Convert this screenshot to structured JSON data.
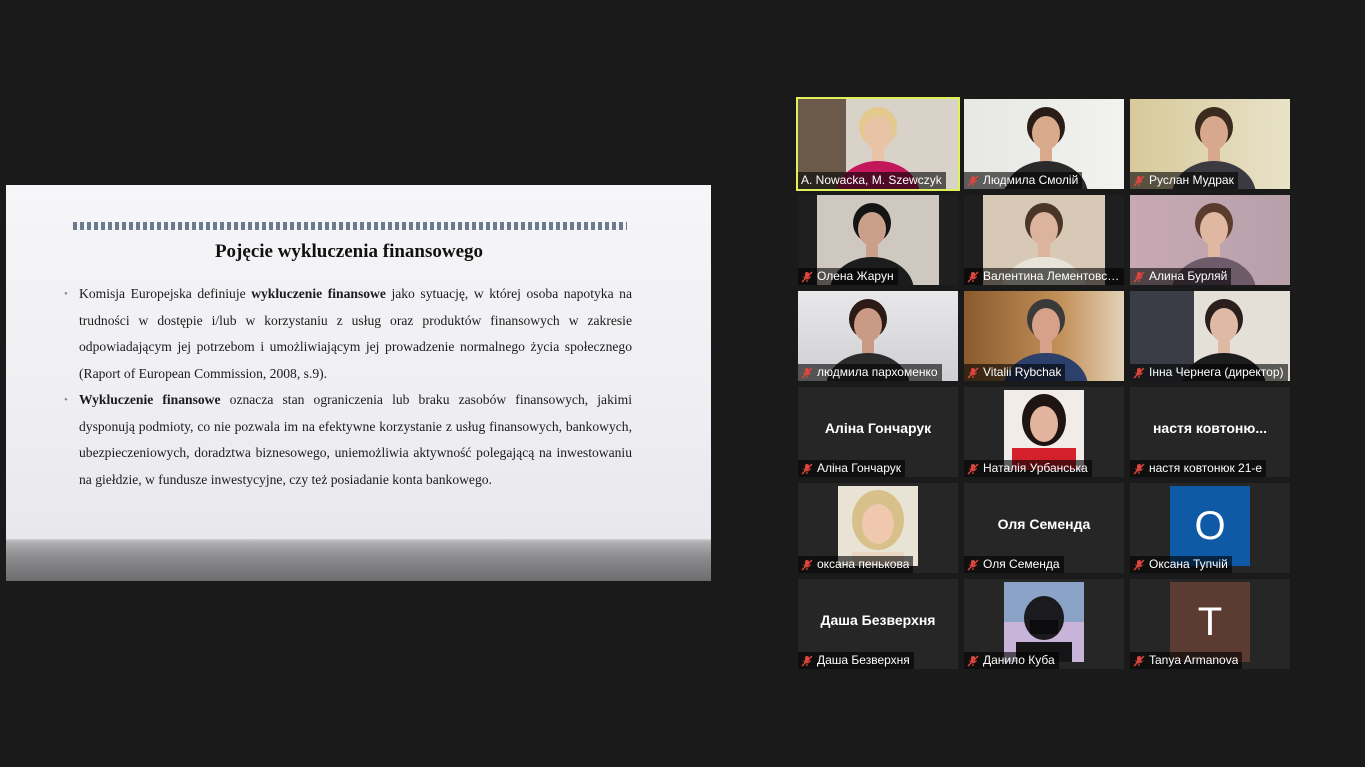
{
  "slide": {
    "title": "Pojęcie wykluczenia finansowego",
    "bullets": [
      {
        "before": "Komisja Europejska definiuje ",
        "bold": "wykluczenie finansowe",
        "after": " jako sytuację, w której osoba napotyka na trudności w dostępie i/lub w korzystaniu z usług oraz produktów finansowych w zakresie odpowiadającym jej potrzebom i umożliwiającym jej prowadzenie normalnego życia społecznego (Raport of  European Commission, 2008, s.9)."
      },
      {
        "before": "",
        "bold": "Wykluczenie finansowe",
        "after": " oznacza stan ograniczenia lub braku zasobów finansowych, jakimi dysponują podmioty, co nie pozwala im na efektywne korzystanie z usług finansowych, bankowych, ubezpieczeniowych, doradztwa biznesowego, uniemożliwia aktywność polegającą na inwestowaniu na giełdzie, w fundusze inwestycyjne, czy też posiadanie konta bankowego."
      }
    ]
  },
  "participants": [
    {
      "name": "A. Nowacka, M. Szewczyk",
      "type": "video",
      "muted": false,
      "active": true
    },
    {
      "name": "Людмила Смолій",
      "type": "video",
      "muted": true
    },
    {
      "name": "Руслан Мудрак",
      "type": "video",
      "muted": true
    },
    {
      "name": "Олена Жарун",
      "type": "video",
      "muted": true
    },
    {
      "name": "Валентина Лементовська",
      "type": "video",
      "muted": true
    },
    {
      "name": "Алина Бурляй",
      "type": "video",
      "muted": true
    },
    {
      "name": "людмила пархоменко",
      "type": "video",
      "muted": true
    },
    {
      "name": "Vitalii Rybchak",
      "type": "video",
      "muted": true
    },
    {
      "name": "Інна Чернега (директор)",
      "type": "video",
      "muted": true
    },
    {
      "name": "Аліна Гончарук",
      "type": "name",
      "display": "Аліна Гончарук",
      "muted": true
    },
    {
      "name": "Наталія Урбанська",
      "type": "photo",
      "muted": true
    },
    {
      "name": "настя ковтонюк 21-е",
      "type": "name",
      "display": "настя  ковтоню...",
      "muted": true
    },
    {
      "name": "оксана пенькова",
      "type": "photo",
      "muted": true
    },
    {
      "name": "Оля Семенда",
      "type": "name",
      "display": "Оля Семенда",
      "muted": true
    },
    {
      "name": "Оксана Тупчій",
      "type": "letter",
      "letter": "O",
      "color": "#0e5aa7",
      "muted": true
    },
    {
      "name": "Даша Безверхня",
      "type": "name",
      "display": "Даша Безверхня",
      "muted": true
    },
    {
      "name": "Данило Куба",
      "type": "photo",
      "muted": true
    },
    {
      "name": "Tanya Armanova",
      "type": "letter",
      "letter": "T",
      "color": "#5c3b32",
      "muted": true
    }
  ],
  "colors": {
    "active_speaker": "#e2f05a",
    "muted_icon": "#e0453c",
    "background": "#1a1a1a"
  }
}
